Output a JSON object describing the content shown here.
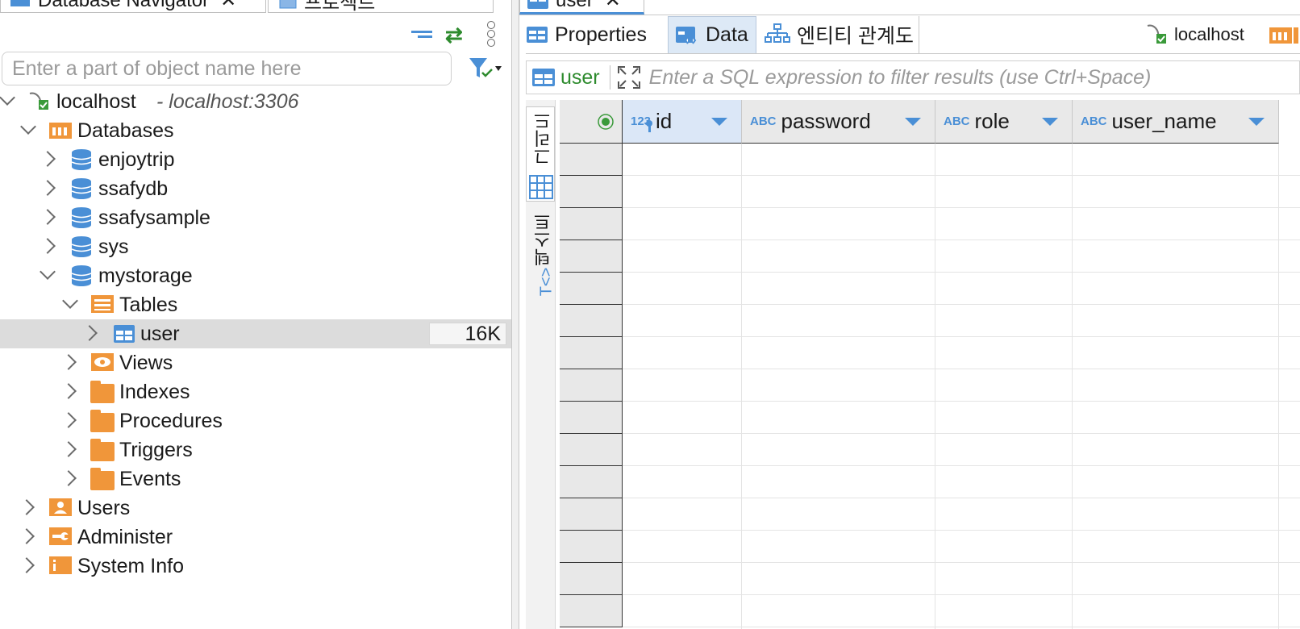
{
  "navigator": {
    "tab_title": "Database Navigator",
    "second_tab_title": "프로젝트",
    "filter_placeholder": "Enter a part of object name here",
    "connection": {
      "name": "localhost",
      "address": "- localhost:3306"
    },
    "databases_label": "Databases",
    "databases": [
      "enjoytrip",
      "ssafydb",
      "ssafysample",
      "sys",
      "mystorage"
    ],
    "tables_label": "Tables",
    "selected_table": {
      "name": "user",
      "size": "16K"
    },
    "schema_folders": [
      "Views",
      "Indexes",
      "Procedures",
      "Triggers",
      "Events"
    ],
    "root_items": [
      "Users",
      "Administer",
      "System Info"
    ]
  },
  "editor": {
    "tab_title": "user",
    "subtabs": {
      "properties": "Properties",
      "data": "Data",
      "erd": "엔티티 관계도"
    },
    "connection_label": "localhost",
    "filter": {
      "table": "user",
      "placeholder": "Enter a SQL expression to filter results (use Ctrl+Space)"
    },
    "side_tabs": {
      "grid": "그리드",
      "text": "텍스트"
    },
    "columns": [
      {
        "type": "123",
        "name": "id"
      },
      {
        "type": "ABC",
        "name": "password"
      },
      {
        "type": "ABC",
        "name": "role"
      },
      {
        "type": "ABC",
        "name": "user_name"
      }
    ]
  },
  "colors": {
    "accent": "#4a8fd6",
    "folder": "#f0963a",
    "green": "#2e8b2e",
    "selection": "#dcdcdc"
  }
}
